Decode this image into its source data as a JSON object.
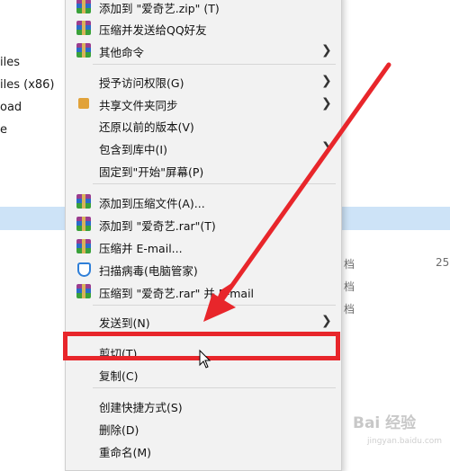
{
  "background": {
    "items": [
      "iles",
      "iles (x86)",
      "oad",
      "e"
    ],
    "right_labels": [
      "档",
      "档",
      "档",
      "25"
    ]
  },
  "menu": {
    "items": [
      {
        "label": "添加到 \"爱奇艺.zip\" (T)",
        "icon": "winrar-icon",
        "submenu": false
      },
      {
        "label": "压缩并发送给QQ好友",
        "icon": "winrar-icon",
        "submenu": false
      },
      {
        "label": "其他命令",
        "icon": "winrar-icon",
        "submenu": true
      },
      {
        "label": "授予访问权限(G)",
        "icon": "",
        "submenu": true
      },
      {
        "label": "共享文件夹同步",
        "icon": "share-sync-icon",
        "submenu": true
      },
      {
        "label": "还原以前的版本(V)",
        "icon": "",
        "submenu": false
      },
      {
        "label": "包含到库中(I)",
        "icon": "",
        "submenu": true
      },
      {
        "label": "固定到\"开始\"屏幕(P)",
        "icon": "",
        "submenu": false
      },
      {
        "label": "添加到压缩文件(A)...",
        "icon": "winrar-icon",
        "submenu": false
      },
      {
        "label": "添加到 \"爱奇艺.rar\"(T)",
        "icon": "winrar-icon",
        "submenu": false
      },
      {
        "label": "压缩并 E-mail...",
        "icon": "winrar-icon",
        "submenu": false
      },
      {
        "label": "扫描病毒(电脑管家)",
        "icon": "shield-icon",
        "submenu": false
      },
      {
        "label": "压缩到 \"爱奇艺.rar\" 并 E-mail",
        "icon": "winrar-icon",
        "submenu": false
      },
      {
        "label": "发送到(N)",
        "icon": "",
        "submenu": true
      },
      {
        "label": "剪切(T)",
        "icon": "",
        "submenu": false
      },
      {
        "label": "复制(C)",
        "icon": "",
        "submenu": false
      },
      {
        "label": "创建快捷方式(S)",
        "icon": "",
        "submenu": false
      },
      {
        "label": "删除(D)",
        "icon": "",
        "submenu": false
      },
      {
        "label": "重命名(M)",
        "icon": "",
        "submenu": false
      }
    ]
  },
  "annotation": {
    "highlight_color": "#e8262b",
    "arrow_color": "#e8262b"
  },
  "watermark": {
    "text": "Bai 经验",
    "sub": "jingyan.baidu.com"
  }
}
